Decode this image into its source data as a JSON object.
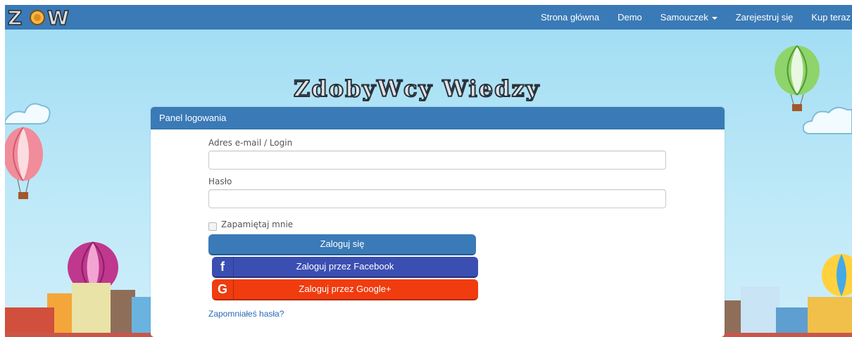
{
  "nav": {
    "links": [
      {
        "label": "Strona główna"
      },
      {
        "label": "Demo"
      },
      {
        "label": "Samouczek"
      },
      {
        "label": "Zarejestruj się"
      },
      {
        "label": "Kup teraz"
      }
    ]
  },
  "brand": {
    "text": "ZOW"
  },
  "logo": {
    "text": "ZdobyWcy Wiedzy"
  },
  "panel": {
    "heading": "Panel logowania",
    "email_label": "Adres e-mail / Login",
    "email_value": "",
    "password_label": "Hasło",
    "password_value": "",
    "remember_label": "Zapamiętaj mnie",
    "login_button": "Zaloguj się",
    "facebook_button": "Zaloguj przez Facebook",
    "google_button": "Zaloguj przez Google+",
    "forgot_link": "Zapomniałeś hasła?"
  },
  "colors": {
    "nav_bg": "#3a7ab7",
    "sky": "#9fdcf3",
    "facebook": "#3b4fb2",
    "google": "#f03c0f"
  }
}
